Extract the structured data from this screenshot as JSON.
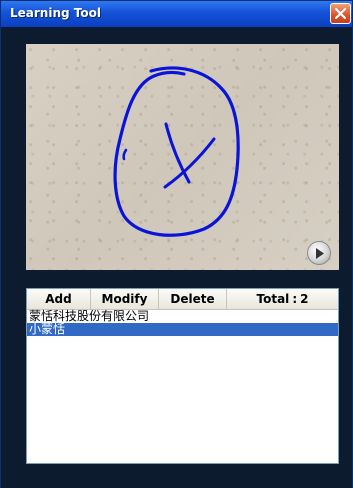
{
  "window": {
    "title": "Learning Tool",
    "accent": "#1452d8"
  },
  "preview": {
    "drawing_color": "#0a14d8"
  },
  "toolbar": {
    "add_label": "Add",
    "modify_label": "Modify",
    "delete_label": "Delete",
    "total_label": "Total",
    "total_separator": ":",
    "total_count": "2"
  },
  "list": {
    "items": [
      {
        "label": "蒙恬科技股份有限公司",
        "selected": false
      },
      {
        "label": "小蒙恬",
        "selected": true
      }
    ],
    "selection_color": "#316ac5"
  },
  "icons": {
    "close": "close-icon",
    "play": "play-icon"
  }
}
